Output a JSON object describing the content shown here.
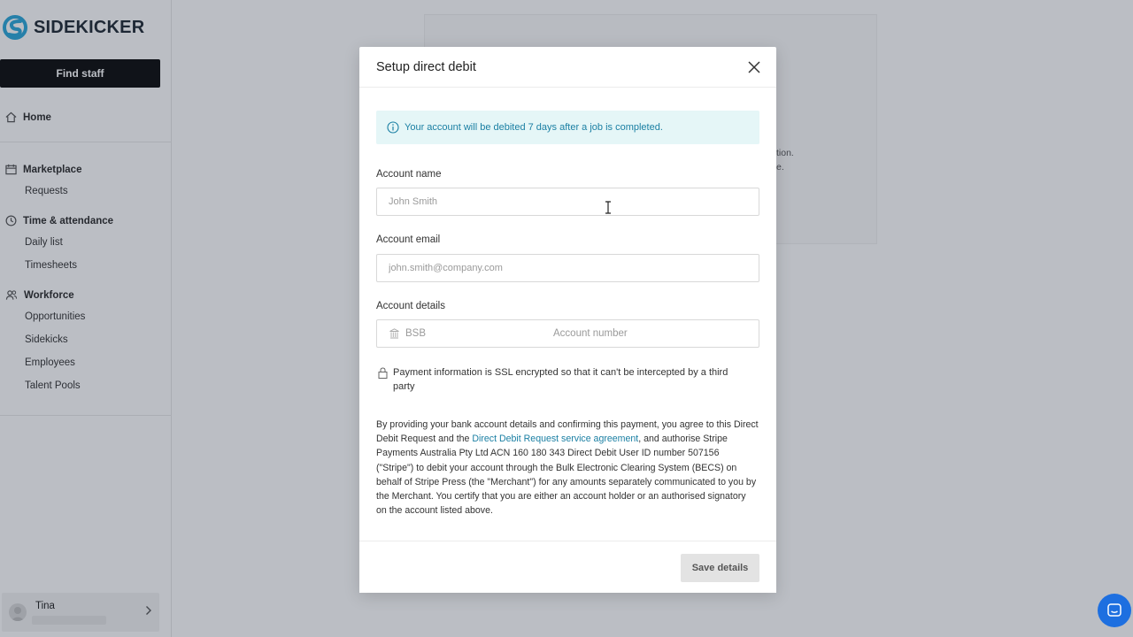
{
  "brand": {
    "name": "SIDEKICKER",
    "accent": "#2aa6d8"
  },
  "sidebar": {
    "find_staff": "Find staff",
    "home": "Home",
    "sections": [
      {
        "label": "Marketplace",
        "items": [
          "Requests"
        ]
      },
      {
        "label": "Time & attendance",
        "items": [
          "Daily list",
          "Timesheets"
        ]
      },
      {
        "label": "Workforce",
        "items": [
          "Opportunities",
          "Sidekicks",
          "Employees",
          "Talent Pools"
        ]
      }
    ],
    "user": {
      "name": "Tina"
    }
  },
  "background": {
    "text_line1": "tion.",
    "text_line2": "e."
  },
  "modal": {
    "title": "Setup direct debit",
    "info": "Your account will be debited 7 days after a job is completed.",
    "account_name": {
      "label": "Account name",
      "placeholder": "John Smith"
    },
    "account_email": {
      "label": "Account email",
      "placeholder": "john.smith@company.com"
    },
    "account_details": {
      "label": "Account details",
      "bsb_placeholder": "BSB",
      "number_placeholder": "Account number"
    },
    "ssl_note": "Payment information is SSL encrypted so that it can't be intercepted by a third party",
    "legal": {
      "part1": "By providing your bank account details and confirming this payment, you agree to this Direct Debit Request and the ",
      "link": "Direct Debit Request service agreement",
      "part2": ", and authorise Stripe Payments Australia Pty Ltd ACN 160 180 343 Direct Debit User ID number 507156 (\"Stripe\") to debit your account through the Bulk Electronic Clearing System (BECS) on behalf of Stripe Press (the \"Merchant\") for any amounts separately communicated to you by the Merchant. You certify that you are either an account holder or an authorised signatory on the account listed above."
    },
    "save_label": "Save details"
  }
}
